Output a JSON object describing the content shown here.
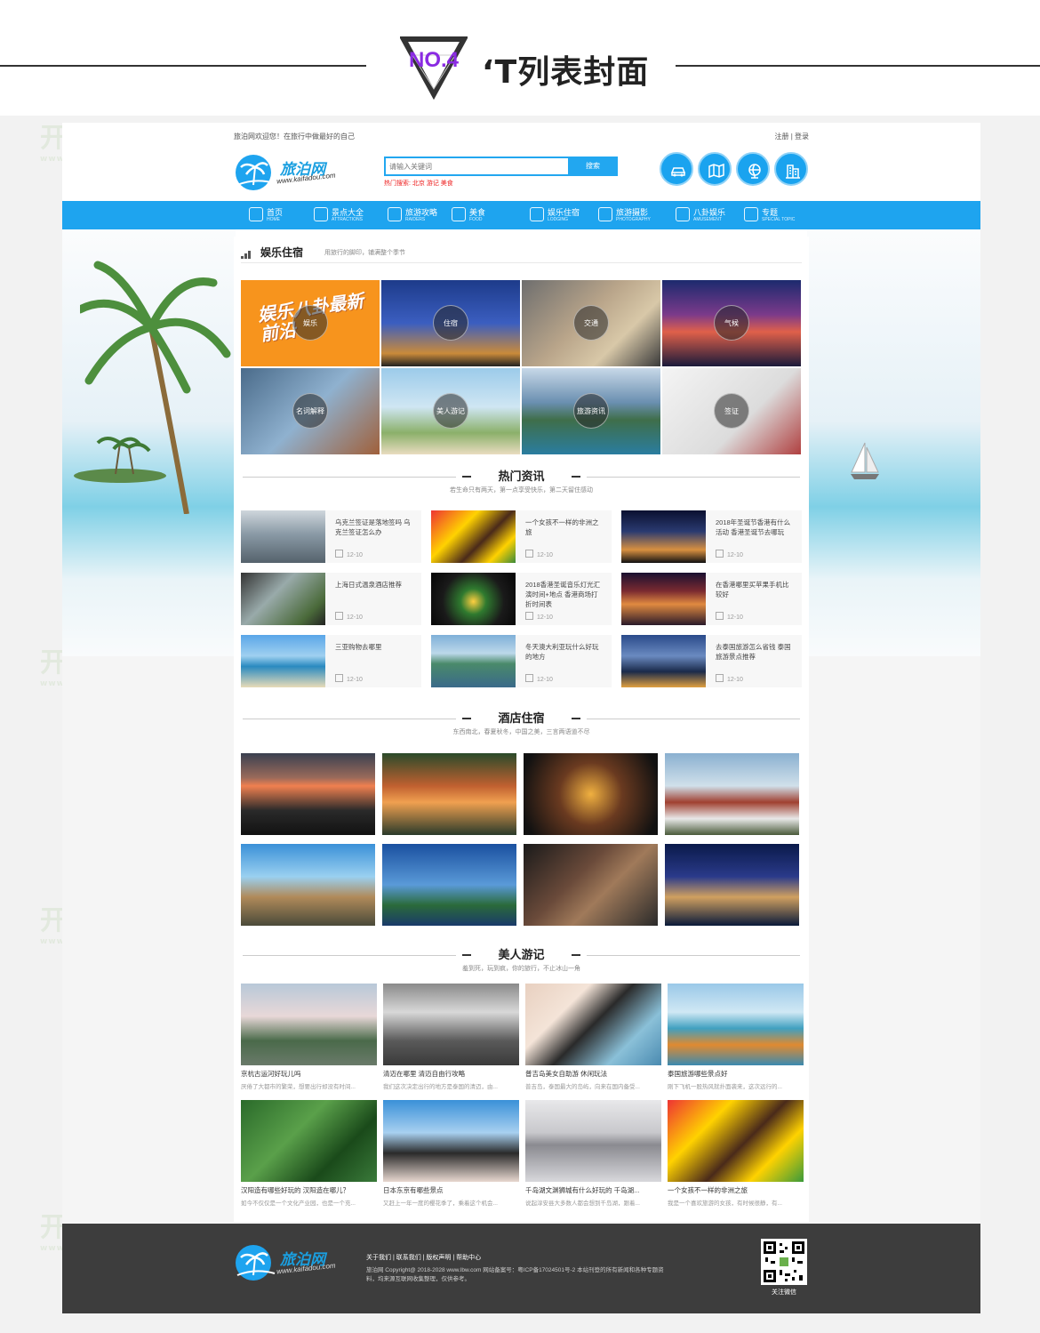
{
  "banner": {
    "badge": "NO.4",
    "title": "‘T列表封面"
  },
  "watermark": {
    "cn": "开发豆",
    "en": "www.kaifadou.com"
  },
  "site": {
    "topbar": {
      "welcome": "旅泊网欢迎您！在旅行中做最好的自己",
      "auth": "注册 | 登录"
    },
    "logo": {
      "name": "旅泊网",
      "domain": "www.kaifadou.com"
    },
    "search": {
      "placeholder": "请输入关键词",
      "button": "搜索",
      "hot": "热门搜索: 北京 游记 美食"
    },
    "nav": [
      {
        "cn": "首页",
        "en": "HOME"
      },
      {
        "cn": "景点大全",
        "en": "ATTRACTIONS"
      },
      {
        "cn": "旅游攻略",
        "en": "RAIDERS"
      },
      {
        "cn": "美食",
        "en": "FOOD"
      },
      {
        "cn": "娱乐住宿",
        "en": "LODGING"
      },
      {
        "cn": "旅游摄影",
        "en": "PHOTOGRAPHY"
      },
      {
        "cn": "八卦娱乐",
        "en": "AMUSEMENT"
      },
      {
        "cn": "专题",
        "en": "SPECIAL TOPIC"
      }
    ],
    "entertainment": {
      "title": "娱乐住宿",
      "subtitle": "用旅行的脚印，铺满整个季节",
      "promo": "娱乐八卦最新前沿",
      "tiles": [
        "娱乐",
        "住宿",
        "交通",
        "气候",
        "名词解释",
        "美人游记",
        "旅游资讯",
        "签证"
      ]
    },
    "hot_news": {
      "title": "热门资讯",
      "subtitle": "若生命只有两天，第一点享受快乐，第二天留住感动",
      "items": [
        {
          "title": "乌克兰签证是落地签吗 乌克兰签证怎么办",
          "date": "12-10"
        },
        {
          "title": "一个女孩不一样的非洲之旅",
          "date": "12-10"
        },
        {
          "title": "2018年圣诞节香港有什么活动 香港圣诞节去哪玩",
          "date": "12-10"
        },
        {
          "title": "上海日式温泉酒店推荐",
          "date": "12-10"
        },
        {
          "title": "2018香港圣诞音乐灯光汇演时间+地点 香港商场打折时间表",
          "date": "12-10"
        },
        {
          "title": "在香港哪里买苹果手机比较好",
          "date": "12-10"
        },
        {
          "title": "三亚购物去哪里",
          "date": "12-10"
        },
        {
          "title": "冬天澳大利亚玩什么好玩的地方",
          "date": "12-10"
        },
        {
          "title": "去泰国旅游怎么省钱 泰国旅游景点推荐",
          "date": "12-10"
        }
      ]
    },
    "hotels": {
      "title": "酒店住宿",
      "subtitle": "东西南北，春夏秋冬，中国之美，三言两语道不尽"
    },
    "beauty": {
      "title": "美人游记",
      "subtitle": "羞到死，玩到疯，你的旅行，不止冰山一角",
      "items": [
        {
          "title": "京杭古运河好玩儿吗",
          "desc": "厌倦了大都市的繁荣，想要出行却没有时间..."
        },
        {
          "title": "清迈在哪里 清迈自由行攻略",
          "desc": "我们这次决定出行的地方是泰国的清迈，由..."
        },
        {
          "title": "普吉岛美女自助游 休闲玩法",
          "desc": "普吉岛，泰国最大的岛屿，向来在国内备受..."
        },
        {
          "title": "泰国旅游哪些景点好",
          "desc": "刚下飞机一股热风就扑面袭来，这次远行的..."
        },
        {
          "title": "汉阳造有哪些好玩的 汉阳造在哪儿？",
          "desc": "如今不仅仅是一个文化产业园，也是一个充..."
        },
        {
          "title": "日本东京有哪些景点",
          "desc": "又赶上一年一度的樱花季了，乘着这个机会..."
        },
        {
          "title": "千岛湖文渊狮城有什么好玩的 千岛湖...",
          "desc": "说起淳安县大多数人都会想到千岛湖，跟着..."
        },
        {
          "title": "一个女孩不一样的非洲之旅",
          "desc": "我是一个喜欢旅游的女孩，有时候很静，有..."
        }
      ]
    },
    "footer": {
      "links": "关于我们 | 联系我们 | 版权声明 | 帮助中心",
      "copyright": "旅泊网 Copyright@ 2018-2028 www.lbw.com 网站备案号：粤ICP备17024501号-2 本站刊登的所有新闻和各种专题资料，均来源互联网收集整理，仅供参考。",
      "qr_caption": "关注微信"
    }
  },
  "colors": {
    "brand": "#1ea4ef",
    "accent": "#8a2be2",
    "footer": "#3d3d3d",
    "promo": "#f7941d"
  }
}
